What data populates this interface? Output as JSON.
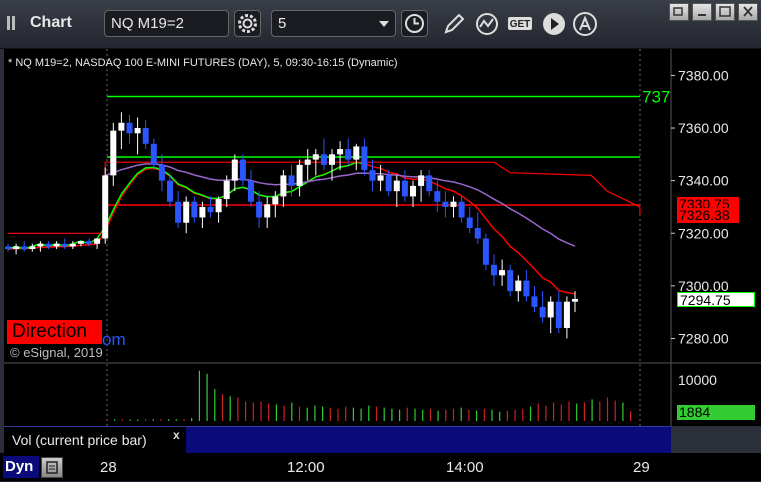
{
  "toolbar": {
    "title": "Chart",
    "symbol": "NQ M19=2",
    "interval": "5",
    "icons": [
      "drag-handle-icon",
      "settings-gear-icon",
      "clock-icon",
      "pencil-icon",
      "line-study-icon",
      "get-icon",
      "play-icon",
      "alert-icon",
      "restore-icon",
      "minimize-icon",
      "maximize-icon",
      "close-icon"
    ],
    "get_label": "GET"
  },
  "chart": {
    "caption": "* NQ M19=2, NASDAQ 100 E-MINI FUTURES (DAY), 5, 09:30-16:15 (Dynamic)",
    "direction_label": "Direction",
    "direction_link": "om",
    "copyright": "© eSignal, 2019",
    "level_label": "737",
    "volume_label": "Vol (current price bar)",
    "volume_close": "x",
    "dyn_label": "Dyn",
    "colors": {
      "background": "#000000",
      "up": "#ffffff",
      "down": "#2b55ff",
      "ema": "#ff0000",
      "vwap": "#00ff00",
      "levels_green": "#00ff00",
      "levels_red": "#ff0000",
      "purple": "#9966cc"
    }
  },
  "chart_data": {
    "type": "candlestick",
    "title": "",
    "y_ticks": [
      "7380.00",
      "7360.00",
      "7340.00",
      "7320.00",
      "7300.00",
      "7280.00"
    ],
    "ylim": [
      7276,
      7387
    ],
    "volume_ticks": [
      "10000"
    ],
    "x_ticks": [
      "28",
      "12:00",
      "14:00",
      "29"
    ],
    "price_tags": [
      {
        "value": "7330.75",
        "color": "#ff0000"
      },
      {
        "value": "7326.38",
        "color": "#ff0000"
      },
      {
        "value": "7294.75",
        "color": "#ffffff"
      },
      {
        "value": "1884",
        "color": "#33cc33"
      }
    ],
    "horizontal_levels": [
      {
        "value": 7372,
        "color": "#00ff00"
      },
      {
        "value": 7349,
        "color": "#00ff00"
      },
      {
        "value": 7330.75,
        "color": "#ff0000"
      }
    ],
    "candles": [
      [
        7315,
        7316,
        7313,
        7314
      ],
      [
        7314,
        7316,
        7312,
        7315
      ],
      [
        7315,
        7317,
        7313,
        7314
      ],
      [
        7314,
        7316,
        7313,
        7315
      ],
      [
        7315,
        7317,
        7313,
        7316
      ],
      [
        7316,
        7317,
        7314,
        7315
      ],
      [
        7315,
        7317,
        7314,
        7316
      ],
      [
        7316,
        7318,
        7314,
        7315
      ],
      [
        7315,
        7317,
        7314,
        7316
      ],
      [
        7316,
        7317,
        7315,
        7317
      ],
      [
        7317,
        7318,
        7315,
        7316
      ],
      [
        7316,
        7318,
        7314,
        7318
      ],
      [
        7318,
        7345,
        7316,
        7342
      ],
      [
        7342,
        7362,
        7338,
        7359
      ],
      [
        7359,
        7366,
        7352,
        7362
      ],
      [
        7362,
        7365,
        7354,
        7358
      ],
      [
        7358,
        7364,
        7350,
        7360
      ],
      [
        7360,
        7363,
        7352,
        7354
      ],
      [
        7354,
        7356,
        7344,
        7346
      ],
      [
        7346,
        7350,
        7336,
        7340
      ],
      [
        7340,
        7342,
        7330,
        7332
      ],
      [
        7332,
        7336,
        7322,
        7324
      ],
      [
        7324,
        7334,
        7320,
        7332
      ],
      [
        7332,
        7334,
        7324,
        7326
      ],
      [
        7326,
        7332,
        7322,
        7330
      ],
      [
        7330,
        7334,
        7326,
        7328
      ],
      [
        7328,
        7334,
        7324,
        7333
      ],
      [
        7333,
        7342,
        7330,
        7340
      ],
      [
        7340,
        7350,
        7336,
        7348
      ],
      [
        7348,
        7350,
        7338,
        7340
      ],
      [
        7340,
        7344,
        7330,
        7332
      ],
      [
        7332,
        7336,
        7322,
        7326
      ],
      [
        7326,
        7334,
        7322,
        7331
      ],
      [
        7331,
        7336,
        7326,
        7334
      ],
      [
        7334,
        7344,
        7330,
        7342
      ],
      [
        7342,
        7346,
        7334,
        7338
      ],
      [
        7338,
        7348,
        7334,
        7346
      ],
      [
        7346,
        7352,
        7340,
        7348
      ],
      [
        7348,
        7352,
        7342,
        7350
      ],
      [
        7350,
        7356,
        7344,
        7346
      ],
      [
        7346,
        7352,
        7340,
        7350
      ],
      [
        7350,
        7355,
        7344,
        7352
      ],
      [
        7352,
        7356,
        7346,
        7348
      ],
      [
        7348,
        7354,
        7344,
        7353
      ],
      [
        7353,
        7356,
        7342,
        7344
      ],
      [
        7344,
        7348,
        7336,
        7340
      ],
      [
        7340,
        7346,
        7336,
        7342
      ],
      [
        7342,
        7344,
        7334,
        7336
      ],
      [
        7336,
        7342,
        7330,
        7340
      ],
      [
        7340,
        7344,
        7332,
        7334
      ],
      [
        7334,
        7340,
        7330,
        7338
      ],
      [
        7338,
        7344,
        7332,
        7342
      ],
      [
        7342,
        7344,
        7334,
        7336
      ],
      [
        7336,
        7340,
        7328,
        7332
      ],
      [
        7332,
        7336,
        7326,
        7330
      ],
      [
        7330,
        7334,
        7326,
        7332
      ],
      [
        7332,
        7334,
        7324,
        7326
      ],
      [
        7326,
        7330,
        7320,
        7322
      ],
      [
        7322,
        7328,
        7316,
        7318
      ],
      [
        7318,
        7320,
        7306,
        7308
      ],
      [
        7308,
        7312,
        7300,
        7304
      ],
      [
        7304,
        7310,
        7300,
        7306
      ],
      [
        7306,
        7308,
        7296,
        7298
      ],
      [
        7298,
        7304,
        7294,
        7302
      ],
      [
        7302,
        7306,
        7294,
        7296
      ],
      [
        7296,
        7300,
        7290,
        7292
      ],
      [
        7292,
        7298,
        7286,
        7288
      ],
      [
        7288,
        7296,
        7282,
        7294
      ],
      [
        7294,
        7298,
        7282,
        7284
      ],
      [
        7284,
        7296,
        7280,
        7294
      ],
      [
        7294,
        7298,
        7290,
        7295
      ]
    ],
    "volumes": [
      300,
      320,
      280,
      300,
      290,
      310,
      330,
      300,
      320,
      340,
      310,
      600,
      9800,
      9200,
      6200,
      5200,
      4800,
      4600,
      3800,
      3600,
      3800,
      3400,
      3200,
      3000,
      3600,
      2800,
      2600,
      3000,
      2800,
      2600,
      2400,
      2800,
      2600,
      2400,
      3000,
      2800,
      2600,
      2400,
      2200,
      2600,
      2400,
      2200,
      2400,
      2000,
      2200,
      2400,
      2600,
      2200,
      2000,
      2400,
      2200,
      1800,
      2000,
      2200,
      2400,
      2800,
      3400,
      3000,
      3600,
      3200,
      3800,
      3400,
      3600,
      4200,
      3800,
      4600,
      4000,
      3600,
      1884
    ]
  }
}
